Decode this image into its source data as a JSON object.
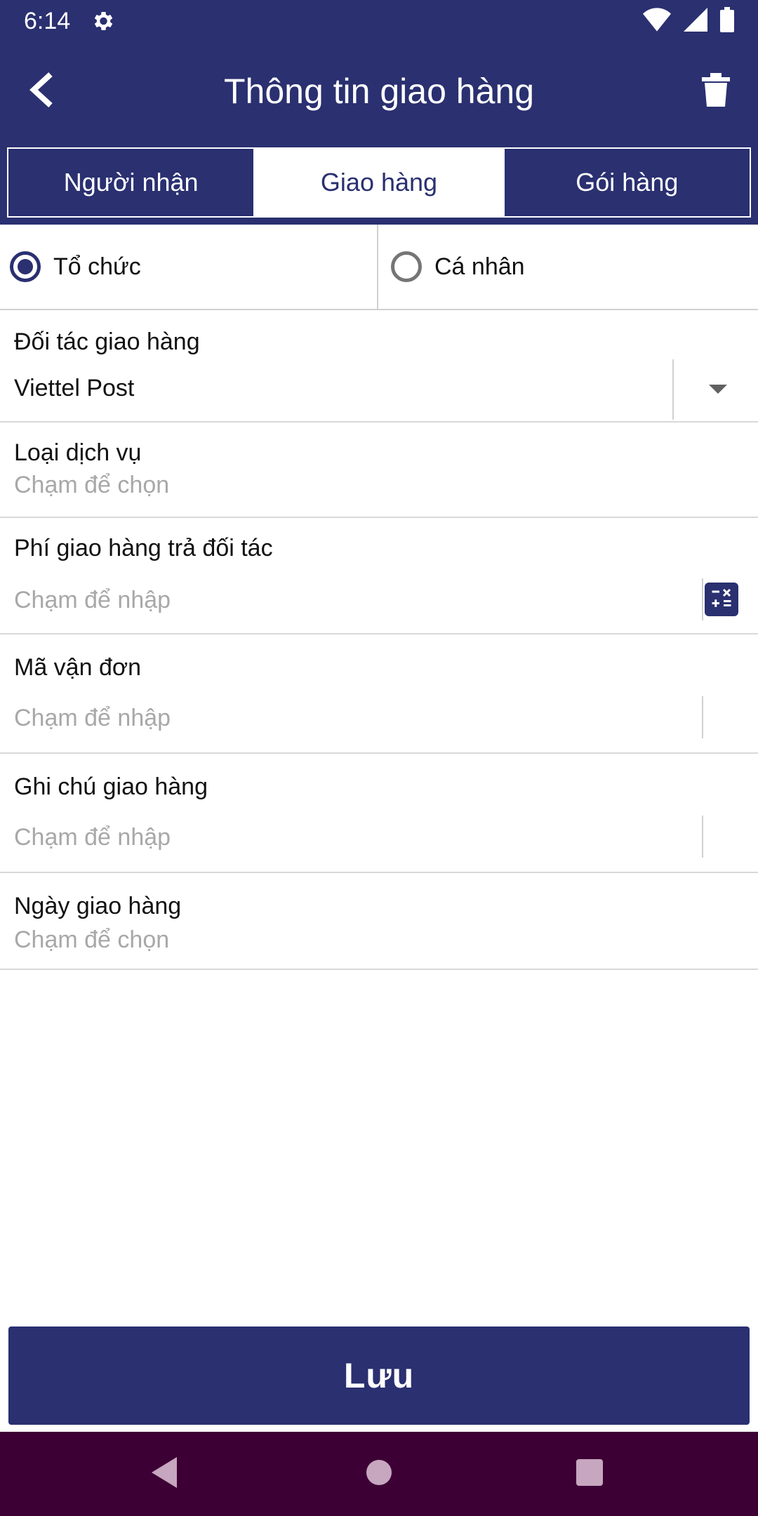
{
  "status_bar": {
    "time": "6:14",
    "icons": [
      "gear-icon",
      "wifi-icon",
      "cellular-signal-icon",
      "battery-icon"
    ]
  },
  "app_bar": {
    "title": "Thông tin giao hàng",
    "back_icon": "chevron-left-icon",
    "delete_icon": "trash-icon"
  },
  "tabs": [
    {
      "label": "Người nhận",
      "active": false
    },
    {
      "label": "Giao hàng",
      "active": true
    },
    {
      "label": "Gói hàng",
      "active": false
    }
  ],
  "recipient_type": {
    "options": [
      {
        "label": "Tổ chức",
        "selected": true
      },
      {
        "label": "Cá nhân",
        "selected": false
      }
    ]
  },
  "fields": {
    "partner": {
      "label": "Đối tác giao hàng",
      "value": "Viettel Post"
    },
    "service_type": {
      "label": "Loại dịch vụ",
      "placeholder": "Chạm để chọn"
    },
    "partner_fee": {
      "label": "Phí giao hàng trả đối tác",
      "placeholder": "Chạm để nhập"
    },
    "tracking_code": {
      "label": "Mã vận đơn",
      "placeholder": "Chạm để nhập"
    },
    "delivery_note": {
      "label": "Ghi chú giao hàng",
      "placeholder": "Chạm để nhập"
    },
    "delivery_date": {
      "label": "Ngày giao hàng",
      "placeholder": "Chạm để chọn"
    }
  },
  "save_button": {
    "label": "Lưu"
  },
  "colors": {
    "primary": "#2a3070",
    "nav_bar": "#3c0035",
    "placeholder": "#a8a8a8"
  }
}
